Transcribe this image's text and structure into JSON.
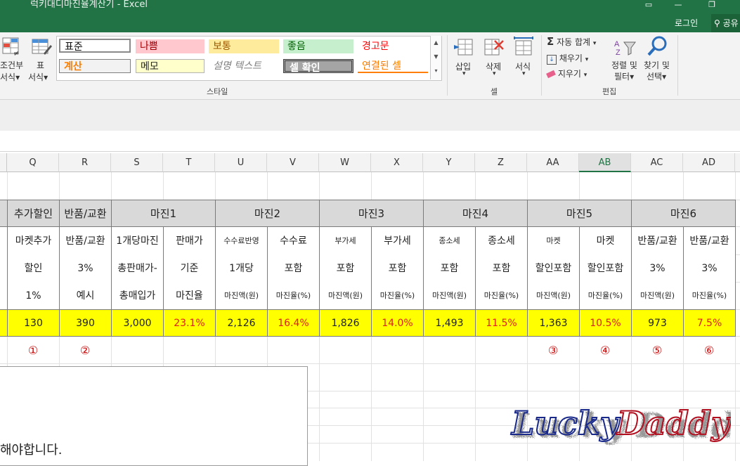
{
  "window": {
    "title": "럭키대디마진율계산기 - Excel",
    "login": "로그인",
    "share": "공유"
  },
  "ribbon": {
    "cond_format": [
      "조건부",
      "서식"
    ],
    "table_format": [
      "표",
      "서식"
    ],
    "styles": {
      "row1": [
        "표준",
        "나쁨",
        "보통",
        "좋음",
        "경고문"
      ],
      "row2": [
        "계산",
        "메모",
        "설명 텍스트",
        "셀 확인",
        "연결된 셀"
      ],
      "label": "스타일"
    },
    "cells": {
      "insert": "삽입",
      "delete": "삭제",
      "format": "서식",
      "label": "셀"
    },
    "editing": {
      "autosum": "자동 합계",
      "fill": "채우기",
      "clear": "지우기",
      "sort_filter": [
        "정렬 및",
        "필터"
      ],
      "find_select": [
        "찾기 및",
        "선택"
      ],
      "label": "편집"
    }
  },
  "columns": [
    "Q",
    "R",
    "S",
    "T",
    "U",
    "V",
    "W",
    "X",
    "Y",
    "Z",
    "AA",
    "AB",
    "AC",
    "AD"
  ],
  "selected_column": "AB",
  "table": {
    "group_headers": [
      "추가할인",
      "반품/교환",
      "마진1",
      "마진2",
      "마진3",
      "마진4",
      "마진5",
      "마진6"
    ],
    "sub_rows": [
      [
        "마켓추가",
        "반품/교환",
        "1개당마진",
        "판매가",
        "수수료반영",
        "수수료",
        "부가세",
        "부가세",
        "종소세",
        "종소세",
        "마켓",
        "마켓",
        "반품/교환",
        "반품/교환"
      ],
      [
        "할인",
        "3%",
        "총판매가-",
        "기준",
        "1개당",
        "포함",
        "포함",
        "포함",
        "포함",
        "포함",
        "할인포함",
        "할인포함",
        "3%",
        "3%"
      ],
      [
        "1%",
        "예시",
        "총매입가",
        "마진율",
        "마진액(원)",
        "마진율(%)",
        "마진액(원)",
        "마진율(%)",
        "마진액(원)",
        "마진율(%)",
        "마진액(원)",
        "마진율(%)",
        "마진액(원)",
        "마진율(%)"
      ]
    ],
    "values": [
      "130",
      "390",
      "3,000",
      "23.1%",
      "2,126",
      "16.4%",
      "1,826",
      "14.0%",
      "1,493",
      "11.5%",
      "1,363",
      "10.5%",
      "973",
      "7.5%"
    ],
    "markers": {
      "Q": "①",
      "R": "②",
      "AA": "③",
      "AB": "④",
      "AC": "⑤",
      "AD": "⑥"
    }
  },
  "textbox": {
    "text": "해야합니다."
  },
  "logo": {
    "text": "Lucky Daddy"
  },
  "colors": {
    "excel_green": "#217346",
    "yellow": "#ffff00",
    "header_gray": "#d9d9d9",
    "red_text": "#e21d1d"
  }
}
